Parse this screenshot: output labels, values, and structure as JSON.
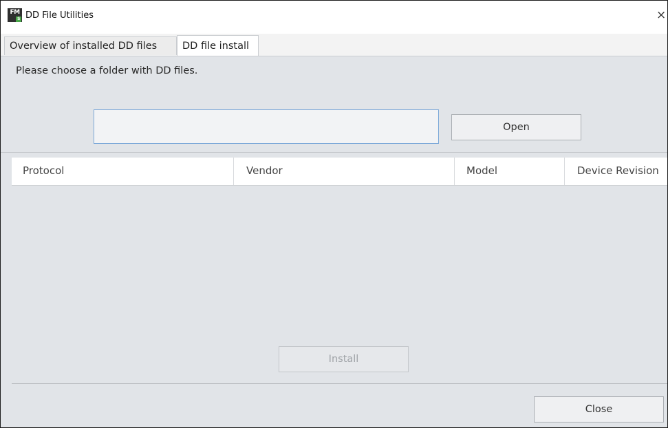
{
  "window": {
    "title": "DD File Utilities",
    "icon_text": "FM",
    "icon_subtext": "S",
    "close_glyph": "×"
  },
  "tabs": [
    {
      "label": "Overview of installed DD files",
      "active": false
    },
    {
      "label": "DD file install",
      "active": true
    }
  ],
  "install_tab": {
    "prompt": "Please choose a folder with DD files.",
    "folder_input": {
      "value": "",
      "placeholder": ""
    },
    "open_label": "Open",
    "table": {
      "columns": [
        "Protocol",
        "Vendor",
        "Model",
        "Device Revision"
      ],
      "rows": []
    },
    "install_label": "Install",
    "install_enabled": false
  },
  "footer": {
    "close_label": "Close"
  },
  "colors": {
    "input_focus_border": "#7aa7d8",
    "panel_background": "#e1e4e8",
    "disabled_text": "#a0a4a8"
  }
}
